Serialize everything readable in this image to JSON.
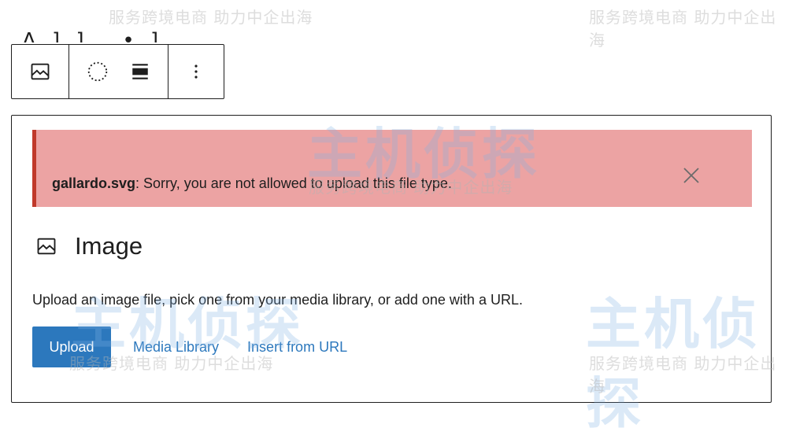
{
  "partial_text": "Λ ] ] ‚ • ]",
  "toolbar": {
    "icons": [
      "image-icon",
      "circle-crop-icon",
      "align-icon",
      "more-options-icon"
    ]
  },
  "notice": {
    "filename": "gallardo.svg",
    "message": ": Sorry, you are not allowed to upload this file type.",
    "close_icon": "close-icon"
  },
  "placeholder": {
    "title": "Image",
    "instructions": "Upload an image file, pick one from your media library, or add one with a URL.",
    "upload_label": "Upload",
    "media_library_label": "Media Library",
    "insert_url_label": "Insert from URL"
  },
  "watermark": {
    "slogan": "服务跨境电商 助力中企出海",
    "brand": "主机侦探"
  },
  "colors": {
    "notice_bg": "#eca3a3",
    "notice_border": "#c0392b",
    "accent": "#2c78bd"
  }
}
